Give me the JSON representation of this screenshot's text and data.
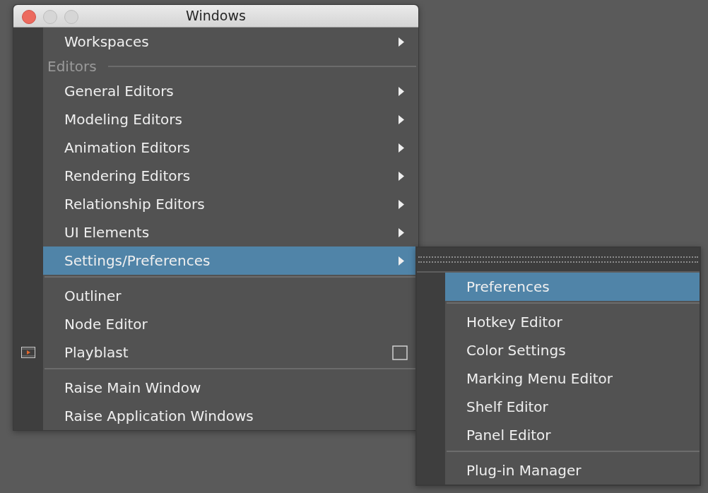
{
  "window": {
    "title": "Windows"
  },
  "menu": {
    "items": [
      {
        "kind": "submenu",
        "label": "Workspaces",
        "selected": false
      },
      {
        "kind": "header",
        "label": "Editors"
      },
      {
        "kind": "submenu",
        "label": "General Editors",
        "selected": false
      },
      {
        "kind": "submenu",
        "label": "Modeling Editors",
        "selected": false
      },
      {
        "kind": "submenu",
        "label": "Animation Editors",
        "selected": false
      },
      {
        "kind": "submenu",
        "label": "Rendering Editors",
        "selected": false
      },
      {
        "kind": "submenu",
        "label": "Relationship Editors",
        "selected": false
      },
      {
        "kind": "submenu",
        "label": "UI Elements",
        "selected": false
      },
      {
        "kind": "submenu",
        "label": "Settings/Preferences",
        "selected": true
      },
      {
        "kind": "separator"
      },
      {
        "kind": "item",
        "label": "Outliner",
        "selected": false
      },
      {
        "kind": "item",
        "label": "Node Editor",
        "selected": false
      },
      {
        "kind": "item",
        "label": "Playblast",
        "selected": false,
        "gutter_icon": true,
        "option_box": true
      },
      {
        "kind": "separator"
      },
      {
        "kind": "item",
        "label": "Raise Main Window",
        "selected": false
      },
      {
        "kind": "item",
        "label": "Raise Application Windows",
        "selected": false
      }
    ]
  },
  "submenu": {
    "items": [
      {
        "kind": "tearoff"
      },
      {
        "kind": "item",
        "label": "Preferences",
        "selected": true
      },
      {
        "kind": "separator"
      },
      {
        "kind": "item",
        "label": "Hotkey Editor",
        "selected": false
      },
      {
        "kind": "item",
        "label": "Color Settings",
        "selected": false
      },
      {
        "kind": "item",
        "label": "Marking Menu Editor",
        "selected": false
      },
      {
        "kind": "item",
        "label": "Shelf Editor",
        "selected": false
      },
      {
        "kind": "item",
        "label": "Panel Editor",
        "selected": false
      },
      {
        "kind": "separator"
      },
      {
        "kind": "item",
        "label": "Plug-in Manager",
        "selected": false
      }
    ]
  }
}
